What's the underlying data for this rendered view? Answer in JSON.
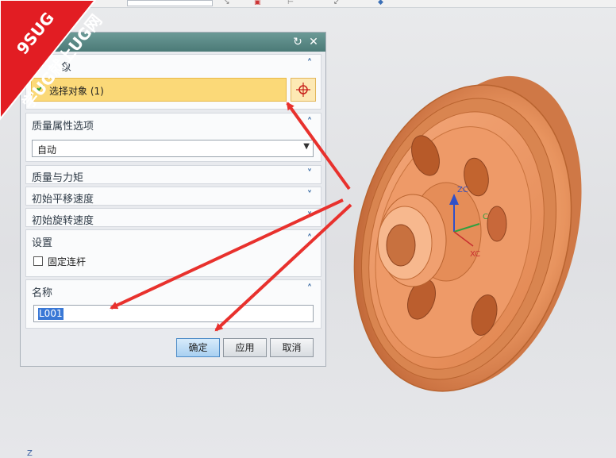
{
  "watermark": {
    "brand": "9SUG",
    "slogan": "学UG就上UG网"
  },
  "dialog": {
    "title_buttons": [
      "reset-icon",
      "close-icon"
    ],
    "sections": {
      "objects": {
        "header": "象",
        "select_label": "选择对象 (1)"
      },
      "mass_props": {
        "header": "质量属性选项",
        "dropdown_value": "自动"
      },
      "mass_force": {
        "header": "质量与力矩"
      },
      "init_translation": {
        "header": "初始平移速度"
      },
      "init_rotation": {
        "header": "初始旋转速度"
      },
      "settings": {
        "header": "设置",
        "checkbox_label": "固定连杆",
        "checkbox_checked": false
      },
      "name": {
        "header": "名称",
        "input_value": "L001"
      }
    },
    "buttons": {
      "ok": "确定",
      "apply": "应用",
      "cancel": "取消"
    }
  },
  "viewport": {
    "triad_labels": {
      "zc": "ZC",
      "yc": "C",
      "xc": "XC"
    },
    "corner_axis": "Z"
  },
  "colors": {
    "dialog_title": "#5b8a86",
    "selection_highlight": "#fbd978",
    "part_color": "#e8945f",
    "annotation_arrow": "#e8312d",
    "watermark_red": "#e21d23"
  }
}
